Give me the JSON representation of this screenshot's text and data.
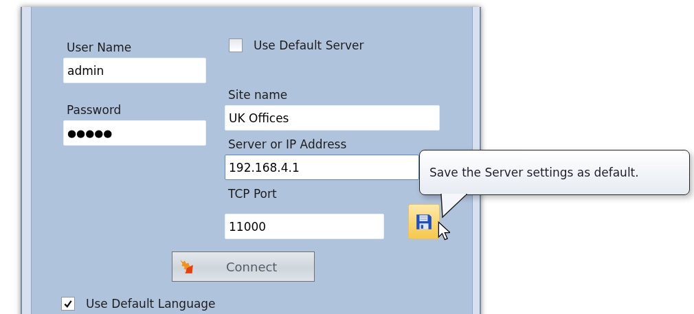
{
  "login": {
    "user_name": {
      "label": "User Name",
      "value": "admin"
    },
    "password": {
      "label": "Password",
      "value": "●●●●●"
    }
  },
  "use_default_server": {
    "label": "Use Default Server",
    "checked": false
  },
  "server": {
    "site_name": {
      "label": "Site name",
      "value": "UK Offices"
    },
    "address": {
      "label": "Server or IP Address",
      "value": "192.168.4.1"
    },
    "tcp_port": {
      "label": "TCP Port",
      "value": "11000"
    }
  },
  "tooltip": {
    "text": "Save the Server settings as default."
  },
  "connect_button": {
    "label": "Connect"
  },
  "use_default_language": {
    "label": "Use Default Language",
    "checked": true
  }
}
